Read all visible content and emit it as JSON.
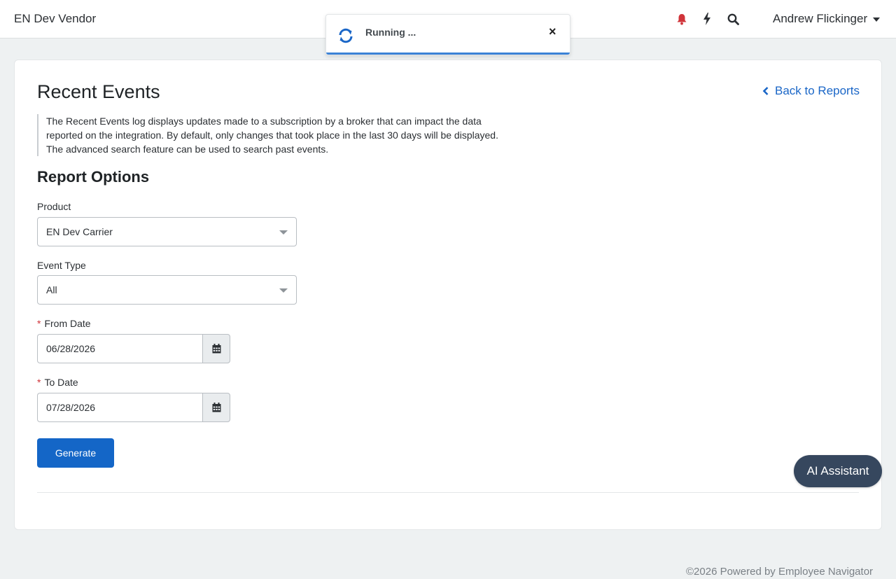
{
  "navbar": {
    "brand": "EN Dev Vendor",
    "icons": [
      "bell-icon",
      "bolt-icon",
      "search-icon"
    ],
    "user_name": "Andrew Flickinger"
  },
  "toast": {
    "text": "Running ...",
    "close_glyph": "×"
  },
  "page": {
    "title": "Recent Events",
    "back_link": "Back to Reports",
    "description": "The Recent Events log displays updates made to a subscription by a broker that can impact the data reported on the integration. By default, only changes that took place in the last 30 days will be displayed. The advanced search feature can be used to search past events.",
    "section_title": "Report Options"
  },
  "form": {
    "product": {
      "label": "Product",
      "value": "EN Dev Carrier"
    },
    "event_type": {
      "label": "Event Type",
      "value": "All"
    },
    "from_date": {
      "label": "From Date",
      "required_mark": "*",
      "value": "06/28/2026"
    },
    "to_date": {
      "label": "To Date",
      "required_mark": "*",
      "value": "07/28/2026"
    },
    "generate_label": "Generate"
  },
  "ai_assistant_label": "AI Assistant",
  "footer": "©2026 Powered by Employee Navigator",
  "colors": {
    "primary": "#1466c7",
    "link": "#1a66c7",
    "alert": "#d0343a",
    "ai_button": "#36475e"
  }
}
